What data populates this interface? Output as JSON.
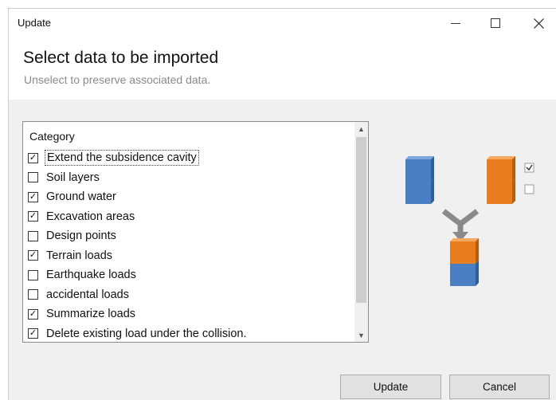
{
  "window": {
    "title": "Update"
  },
  "header": {
    "title": "Select data to be imported",
    "subtitle": "Unselect to preserve associated data."
  },
  "list": {
    "column_header": "Category",
    "items": [
      {
        "label": "Extend the subsidence cavity",
        "checked": true,
        "focused": true
      },
      {
        "label": "Soil layers",
        "checked": false
      },
      {
        "label": "Ground water",
        "checked": true
      },
      {
        "label": "Excavation areas",
        "checked": true
      },
      {
        "label": "Design points",
        "checked": false
      },
      {
        "label": "Terrain loads",
        "checked": true
      },
      {
        "label": "Earthquake loads",
        "checked": false
      },
      {
        "label": "accidental loads",
        "checked": false
      },
      {
        "label": "Summarize loads",
        "checked": true
      },
      {
        "label": "Delete existing load under the collision.",
        "checked": true
      }
    ]
  },
  "buttons": {
    "update": "Update",
    "cancel": "Cancel"
  },
  "colors": {
    "blue_cube": "#4a7fc4",
    "orange_cube": "#e87d1e",
    "arrow": "#8a8a8a"
  }
}
